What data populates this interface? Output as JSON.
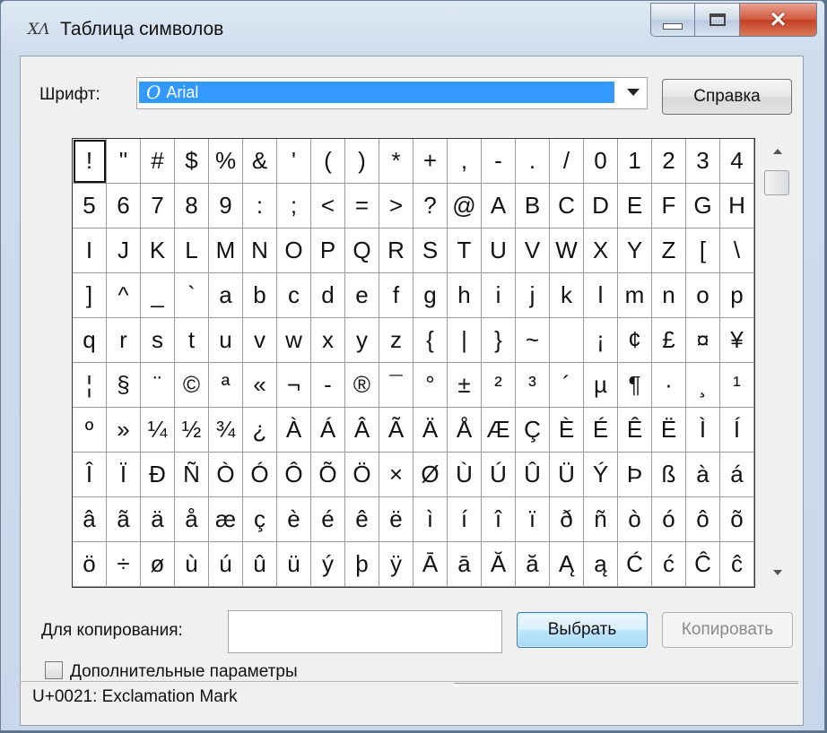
{
  "window": {
    "title": "Таблица символов",
    "icon": "charmap-icon",
    "icon_glyph": "XΛ",
    "close_glyph": "✕"
  },
  "font": {
    "label": "Шрифт:",
    "selected": "Arial",
    "font_icon_glyph": "O"
  },
  "buttons": {
    "help": "Справка",
    "select": "Выбрать",
    "copy": "Копировать"
  },
  "copy_field": {
    "label": "Для копирования:",
    "value": ""
  },
  "advanced": {
    "label": "Дополнительные параметры",
    "checked": false
  },
  "status": {
    "text": "U+0021: Exclamation Mark"
  },
  "grid": {
    "selected_index": 0,
    "rows": [
      [
        "!",
        "\"",
        "#",
        "$",
        "%",
        "&",
        "'",
        "(",
        ")",
        "*",
        "+",
        ",",
        "-",
        ".",
        "/",
        "0",
        "1",
        "2",
        "3",
        "4"
      ],
      [
        "5",
        "6",
        "7",
        "8",
        "9",
        ":",
        ";",
        "<",
        "=",
        ">",
        "?",
        "@",
        "A",
        "B",
        "C",
        "D",
        "E",
        "F",
        "G",
        "H"
      ],
      [
        "I",
        "J",
        "K",
        "L",
        "M",
        "N",
        "O",
        "P",
        "Q",
        "R",
        "S",
        "T",
        "U",
        "V",
        "W",
        "X",
        "Y",
        "Z",
        "[",
        "\\"
      ],
      [
        "]",
        "^",
        "_",
        "`",
        "a",
        "b",
        "c",
        "d",
        "e",
        "f",
        "g",
        "h",
        "i",
        "j",
        "k",
        "l",
        "m",
        "n",
        "o",
        "p"
      ],
      [
        "q",
        "r",
        "s",
        "t",
        "u",
        "v",
        "w",
        "x",
        "y",
        "z",
        "{",
        "|",
        "}",
        "~",
        " ",
        "¡",
        "¢",
        "£",
        "¤",
        "¥"
      ],
      [
        "¦",
        "§",
        "¨",
        "©",
        "ª",
        "«",
        "¬",
        "-",
        "®",
        "¯",
        "°",
        "±",
        "²",
        "³",
        "´",
        "µ",
        "¶",
        "·",
        "¸",
        "¹"
      ],
      [
        "º",
        "»",
        "¼",
        "½",
        "¾",
        "¿",
        "À",
        "Á",
        "Â",
        "Ã",
        "Ä",
        "Å",
        "Æ",
        "Ç",
        "È",
        "É",
        "Ê",
        "Ë",
        "Ì",
        "Í"
      ],
      [
        "Î",
        "Ï",
        "Ð",
        "Ñ",
        "Ò",
        "Ó",
        "Ô",
        "Õ",
        "Ö",
        "×",
        "Ø",
        "Ù",
        "Ú",
        "Û",
        "Ü",
        "Ý",
        "Þ",
        "ß",
        "à",
        "á"
      ],
      [
        "â",
        "ã",
        "ä",
        "å",
        "æ",
        "ç",
        "è",
        "é",
        "ê",
        "ë",
        "ì",
        "í",
        "î",
        "ï",
        "ð",
        "ñ",
        "ò",
        "ó",
        "ô",
        "õ"
      ],
      [
        "ö",
        "÷",
        "ø",
        "ù",
        "ú",
        "û",
        "ü",
        "ý",
        "þ",
        "ÿ",
        "Ā",
        "ā",
        "Ă",
        "ă",
        "Ą",
        "ą",
        "Ć",
        "ć",
        "Ĉ",
        "ĉ"
      ]
    ]
  }
}
